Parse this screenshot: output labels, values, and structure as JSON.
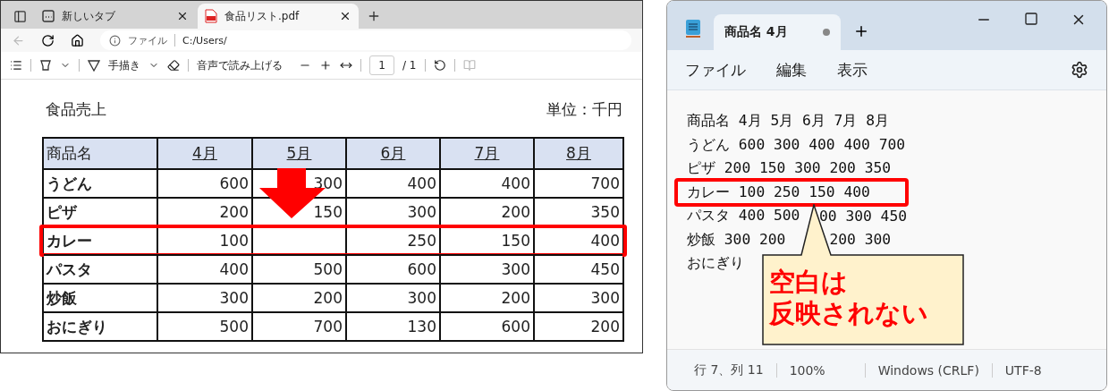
{
  "browser": {
    "tabs": [
      {
        "kind": "newtab",
        "label": "新しいタブ",
        "selected": false
      },
      {
        "kind": "pdf",
        "label": "食品リスト.pdf",
        "selected": true
      }
    ],
    "address": {
      "scheme": "ファイル",
      "url": "C:/Users/"
    },
    "toolbar": {
      "draw": "手描き",
      "read_aloud": "音声で読み上げる",
      "page": "1",
      "page_total": "/ 1"
    },
    "document": {
      "title": "食品売上",
      "unit": "単位：千円",
      "columns": [
        "商品名",
        "4月",
        "5月",
        "6月",
        "7月",
        "8月"
      ],
      "rows": [
        {
          "cells": [
            "うどん",
            "600",
            "300",
            "400",
            "400",
            "700"
          ],
          "highlighted": false
        },
        {
          "cells": [
            "ピザ",
            "200",
            "150",
            "300",
            "200",
            "350"
          ],
          "highlighted": false
        },
        {
          "cells": [
            "カレー",
            "100",
            "",
            "250",
            "150",
            "400"
          ],
          "highlighted": true
        },
        {
          "cells": [
            "パスタ",
            "400",
            "500",
            "600",
            "300",
            "450"
          ],
          "highlighted": false
        },
        {
          "cells": [
            "炒飯",
            "300",
            "200",
            "300",
            "200",
            "300"
          ],
          "highlighted": false
        },
        {
          "cells": [
            "おにぎり",
            "500",
            "700",
            "130",
            "600",
            "200"
          ],
          "highlighted": false
        }
      ]
    }
  },
  "notepad": {
    "tab": {
      "title": "商品名 4月",
      "unsaved": true
    },
    "menu": [
      "ファイル",
      "編集",
      "表示"
    ],
    "lines": [
      {
        "segments": [
          "商品名 4月 5月 6月 7月 8月"
        ],
        "highlighted": false
      },
      {
        "segments": [
          "うどん 600 300 400 400 700"
        ],
        "highlighted": false
      },
      {
        "segments": [
          "ピザ 200 150 300 200 350"
        ],
        "highlighted": false
      },
      {
        "segments": [
          "カレー 100 250 150 400"
        ],
        "highlighted": true
      },
      {
        "segments": [
          "パスタ 400 500",
          "00 300 450"
        ],
        "highlighted": false
      },
      {
        "segments": [
          "炒飯 300 200",
          "200 300"
        ],
        "highlighted": false
      },
      {
        "segments": [
          "おにぎり"
        ],
        "highlighted": false
      }
    ],
    "callout": {
      "lines": [
        "空白は",
        "反映されない"
      ]
    },
    "status": [
      "行 7、列 11",
      "100%",
      "Windows (CRLF)",
      "UTF-8"
    ]
  }
}
